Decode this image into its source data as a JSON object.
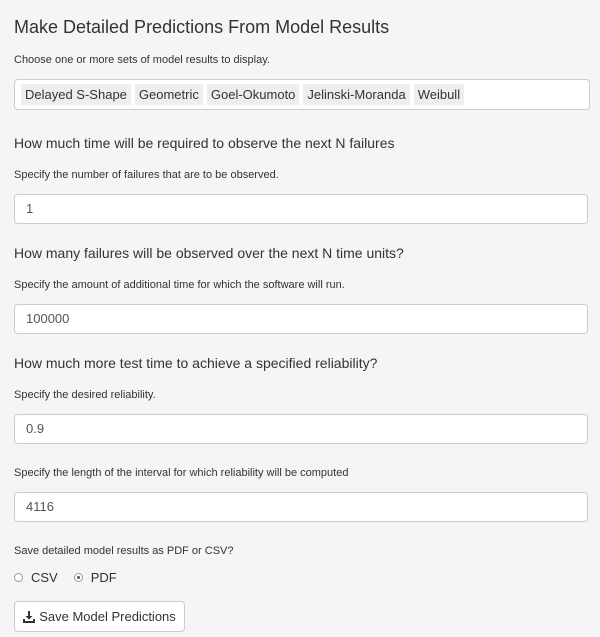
{
  "title": "Make Detailed Predictions From Model Results",
  "models": {
    "help": "Choose one or more sets of model results to display.",
    "selected": [
      "Delayed S-Shape",
      "Geometric",
      "Goel-Okumoto",
      "Jelinski-Moranda",
      "Weibull"
    ]
  },
  "failures": {
    "heading": "How much time will be required to observe the next N failures",
    "help": "Specify the number of failures that are to be observed.",
    "value": "1"
  },
  "time_units": {
    "heading": "How many failures will be observed over the next N time units?",
    "help": "Specify the amount of additional time for which the software will run.",
    "value": "100000"
  },
  "reliability": {
    "heading": "How much more test time to achieve a specified reliability?",
    "help": "Specify the desired reliability.",
    "value": "0.9"
  },
  "interval": {
    "help": "Specify the length of the interval for which reliability will be computed",
    "value": "4116"
  },
  "save": {
    "help": "Save detailed model results as PDF or CSV?",
    "options": [
      {
        "label": "CSV",
        "checked": false
      },
      {
        "label": "PDF",
        "checked": true
      }
    ],
    "button_label": "Save Model Predictions",
    "button_icon": "download-icon"
  }
}
